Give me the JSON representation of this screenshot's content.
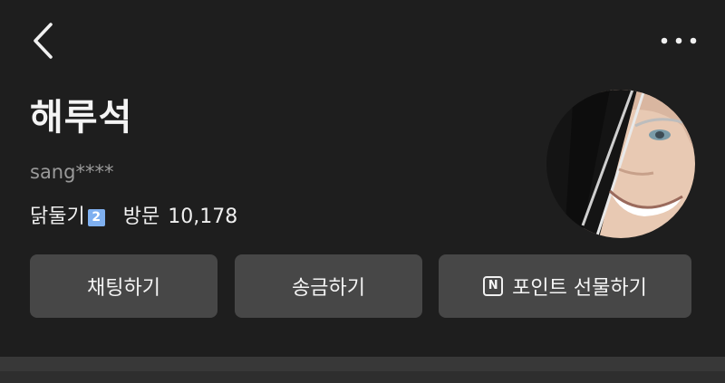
{
  "profile": {
    "name": "해루석",
    "user_id": "sang****",
    "level_label": "닭둘기",
    "level_badge": "2",
    "visit_label": "방문",
    "visit_count": "10,178"
  },
  "actions": {
    "chat_label": "채팅하기",
    "send_label": "송금하기",
    "gift_label": "포인트 선물하기",
    "gift_icon_text": "N"
  },
  "icons": {
    "back": "chevron-left-icon",
    "more": "more-horizontal-icon",
    "gift": "npay-point-icon"
  },
  "colors": {
    "background": "#1e1e1e",
    "button": "#474747",
    "badge": "#7fb0f0"
  }
}
